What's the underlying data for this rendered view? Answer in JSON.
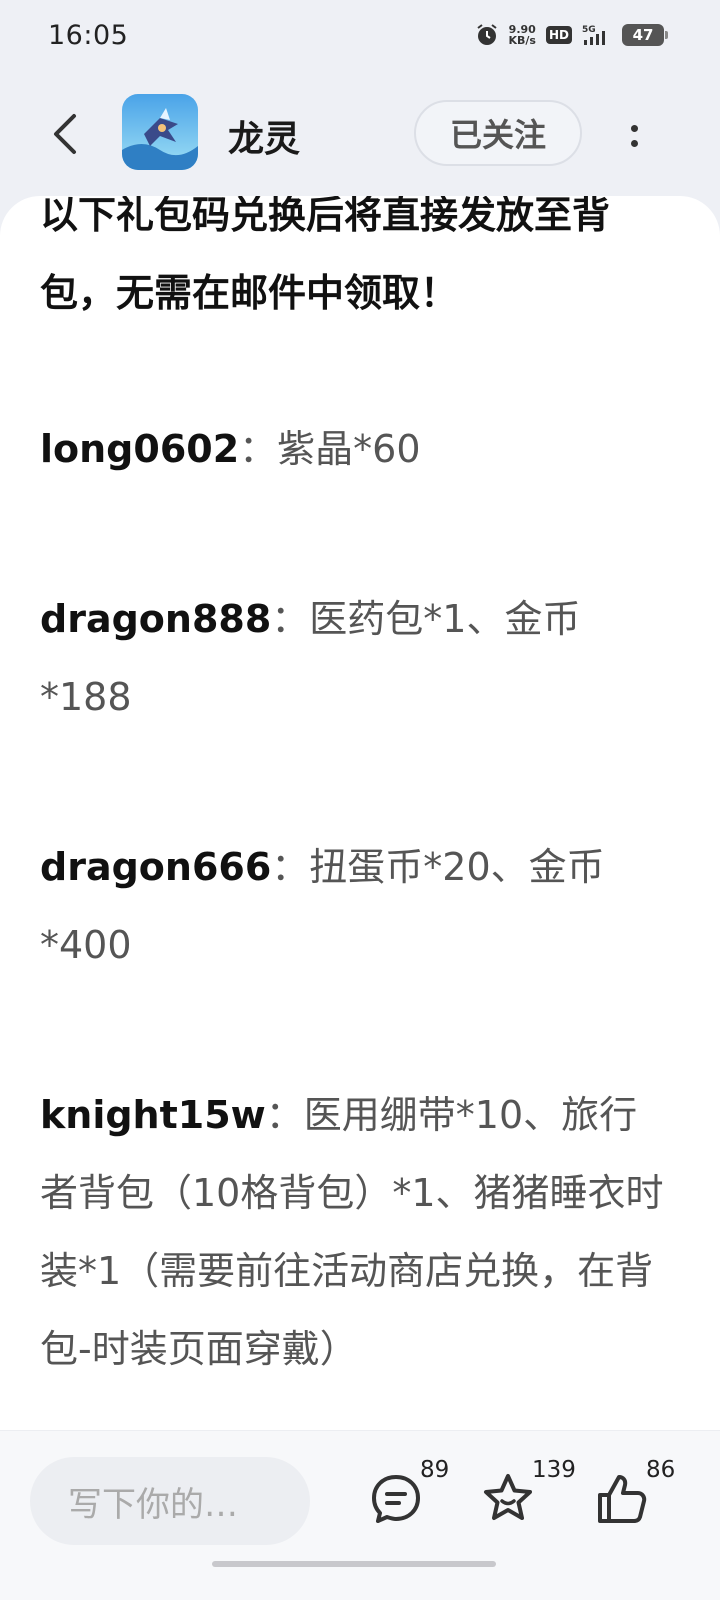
{
  "status_bar": {
    "time": "16:05",
    "net_speed_value": "9.90",
    "net_speed_unit": "KB/s",
    "hd_badge": "HD",
    "network": "5G",
    "battery": "47",
    "icons": [
      "alarm-icon",
      "signal-icon",
      "battery-icon"
    ]
  },
  "header": {
    "title": "龙灵",
    "follow_label": "已关注",
    "icons": [
      "back-arrow-icon",
      "app-avatar",
      "more-dots-icon"
    ]
  },
  "article": {
    "intro": "以下礼包码兑换后将直接发放至背包，无需在邮件中领取！",
    "entries": [
      {
        "code": "long0602",
        "sep": "：",
        "reward": "紫晶*60"
      },
      {
        "code": "dragon888",
        "sep": "：",
        "reward": "医药包*1、金币*188"
      },
      {
        "code": "dragon666",
        "sep": "：",
        "reward": "扭蛋币*20、金币*400"
      },
      {
        "code": "knight15w",
        "sep": "：",
        "reward": "医用绷带*10、旅行者背包（10格背包）*1、猪猪睡衣时装*1（需要前往活动商店兑换，在背包-时装页面穿戴）"
      }
    ]
  },
  "bottom_bar": {
    "comment_placeholder": "写下你的…",
    "comment_count": "89",
    "favorite_count": "139",
    "like_count": "86",
    "icons": [
      "comment-icon",
      "star-icon",
      "thumbs-up-icon"
    ]
  },
  "colors": {
    "page_bg": "#eef0f5",
    "content_bg": "#ffffff",
    "text_primary": "#111111",
    "text_secondary": "#555555"
  }
}
